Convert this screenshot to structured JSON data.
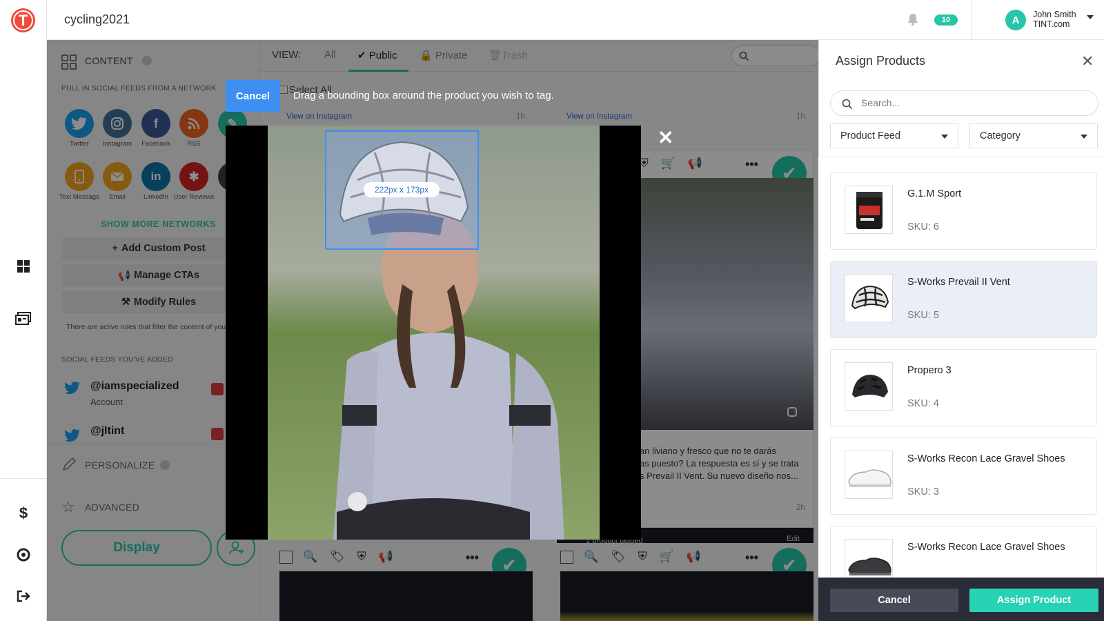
{
  "app": {
    "name": "cycling2021"
  },
  "header": {
    "notifications_count": "10",
    "avatar_letter": "A",
    "user_name": "John Smith",
    "user_org": "TINT.com"
  },
  "content_panel": {
    "title": "CONTENT",
    "pull_label": "PULL IN SOCIAL FEEDS FROM A NETWORK",
    "networks": [
      {
        "label": "Twitter",
        "icon": "twitter-icon",
        "color": "#1da1f2"
      },
      {
        "label": "Instagram",
        "icon": "instagram-icon",
        "color": "#3f729b"
      },
      {
        "label": "Facebook",
        "icon": "facebook-icon",
        "color": "#3b5998"
      },
      {
        "label": "RSS",
        "icon": "rss-icon",
        "color": "#f26522"
      },
      {
        "label": "Text Message",
        "icon": "phone-icon",
        "color": "#f4a51c"
      },
      {
        "label": "Email",
        "icon": "email-icon",
        "color": "#f4a51c"
      },
      {
        "label": "LinkedIn",
        "icon": "linkedin-icon",
        "color": "#0e76a8"
      },
      {
        "label": "User Reviews",
        "icon": "yelp-icon",
        "color": "#d32323"
      }
    ],
    "show_more": "SHOW MORE NETWORKS",
    "add_custom_post": "Add Custom Post",
    "manage_ctas": "Manage CTAs",
    "modify_rules": "Modify Rules",
    "rules_note": "There are active rules that filter the content of you",
    "feeds_label": "SOCIAL FEEDS YOU'VE ADDED",
    "feeds": [
      {
        "handle": "@iamspecialized",
        "type": "Account"
      },
      {
        "handle": "@jltint",
        "type": ""
      }
    ],
    "personalize": "PERSONALIZE",
    "advanced": "ADVANCED",
    "display_button": "Display"
  },
  "feed": {
    "view_label": "VIEW:",
    "tabs": [
      "All",
      "Public",
      "Private",
      "Trash"
    ],
    "active_tab": "Public",
    "select_all": "Select All",
    "view_on_instagram": "View on Instagram",
    "time_1h": "1h",
    "time_2h": "2h",
    "post_text": "an liviano y fresco que no te darás\nas puesto? La respuesta es sí y se trata\ns Prevail II Vent. Su nuevo diseño nos...",
    "product_tagged": "1 product tagged",
    "edit": "Edit"
  },
  "tagging_overlay": {
    "cancel": "Cancel",
    "instruction": "Drag a bounding box around the product you wish to tag.",
    "bbox_size": "222px x 173px"
  },
  "assign_panel": {
    "title": "Assign Products",
    "search_placeholder": "Search...",
    "product_feed": "Product Feed",
    "category": "Category",
    "products": [
      {
        "name": "G.1.M Sport",
        "sku": "SKU: 6",
        "selected": false
      },
      {
        "name": "S-Works Prevail II Vent",
        "sku": "SKU: 5",
        "selected": true
      },
      {
        "name": "Propero 3",
        "sku": "SKU: 4",
        "selected": false
      },
      {
        "name": "S-Works Recon Lace Gravel Shoes",
        "sku": "SKU: 3",
        "selected": false
      },
      {
        "name": "S-Works Recon Lace Gravel Shoes",
        "sku": "",
        "selected": false
      }
    ],
    "cancel": "Cancel",
    "assign": "Assign Product"
  },
  "colors": {
    "accent": "#27c6a8",
    "primary_blue": "#3d8ff2",
    "brand_red": "#ef4b3c"
  }
}
